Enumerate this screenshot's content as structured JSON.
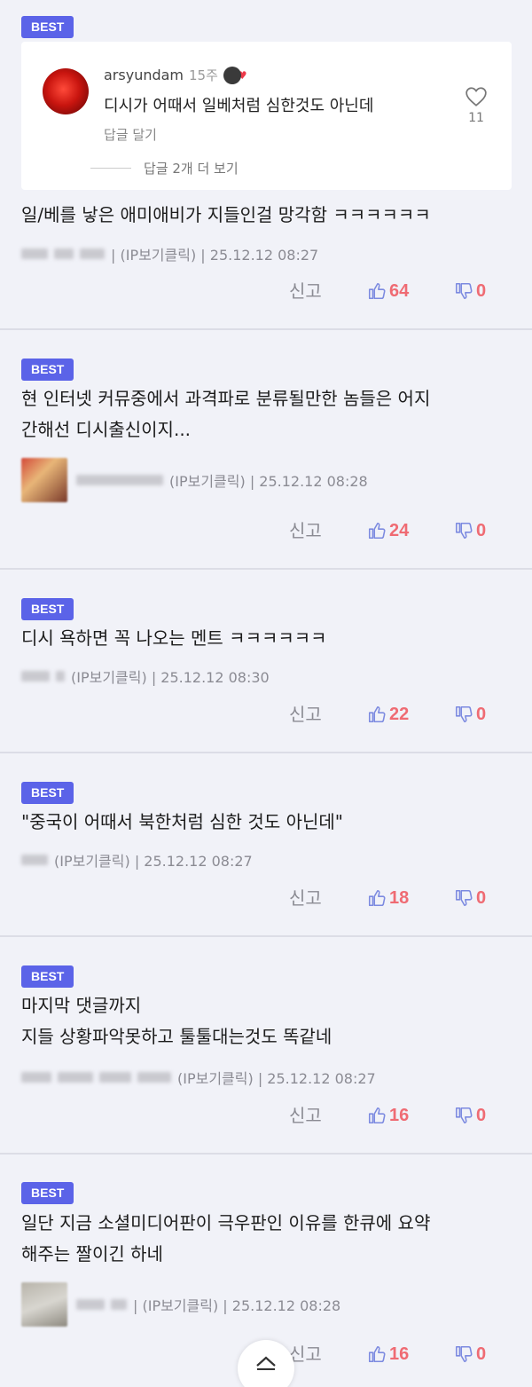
{
  "best_label": "BEST",
  "reply_card": {
    "username": "arsyundam",
    "time": "15주",
    "text": "디시가 어때서 일베처럼 심한것도 아닌데",
    "reply_label": "답글 달기",
    "more_replies": "답글 2개 더 보기",
    "like_count": "11"
  },
  "report_label": "신고",
  "comments": [
    {
      "lines": [
        "일/베를 낳은 애미애비가 지들인걸 망각함 ㅋㅋㅋㅋㅋㅋ"
      ],
      "meta": "| (IP보기클릭) | 25.12.12 08:27",
      "likes": "64",
      "dislikes": "0"
    },
    {
      "lines": [
        "현 인터넷 커뮤중에서 과격파로 분류될만한 놈들은 어지",
        "간해선 디시출신이지..."
      ],
      "meta": "(IP보기클릭) | 25.12.12 08:28",
      "likes": "24",
      "dislikes": "0"
    },
    {
      "lines": [
        "디시 욕하면 꼭 나오는 멘트 ㅋㅋㅋㅋㅋㅋ"
      ],
      "meta": "(IP보기클릭) | 25.12.12 08:30",
      "likes": "22",
      "dislikes": "0"
    },
    {
      "lines": [
        "\"중국이 어때서 북한처럼 심한 것도 아닌데\""
      ],
      "meta": "(IP보기클릭) | 25.12.12 08:27",
      "likes": "18",
      "dislikes": "0"
    },
    {
      "lines": [
        "마지막 댓글까지",
        "지들 상황파악못하고 툴툴대는것도 똑같네"
      ],
      "meta": "(IP보기클릭) | 25.12.12 08:27",
      "likes": "16",
      "dislikes": "0"
    },
    {
      "lines": [
        "일단 지금 소셜미디어판이 극우판인 이유를 한큐에 요약",
        "해주는 짤이긴 하네"
      ],
      "meta": "| (IP보기클릭) | 25.12.12 08:28",
      "likes": "16",
      "dislikes": "0"
    }
  ],
  "colors": {
    "best_bg": "#5b63e8",
    "like_count": "#ef6b73",
    "thumb_up": "#7c8ae0",
    "thumb_down": "#7c8ae0"
  },
  "icons": [
    "heart-icon",
    "thumbs-up-icon",
    "thumbs-down-icon",
    "chevron-up-icon"
  ]
}
